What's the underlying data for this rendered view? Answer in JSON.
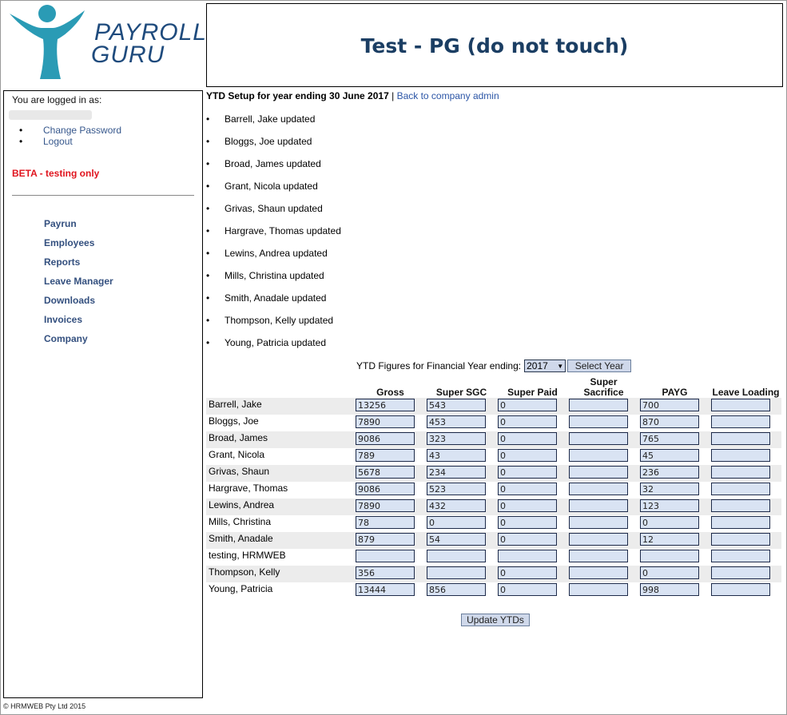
{
  "logo": {
    "line1": "PAYROLL",
    "line2": "GURU"
  },
  "header": {
    "title": "Test - PG (do not touch)"
  },
  "sidebar": {
    "logged_in_label": "You are logged in as:",
    "account_links": [
      "Change Password",
      "Logout"
    ],
    "beta_notice": "BETA - testing only",
    "nav_items": [
      "Payrun",
      "Employees",
      "Reports",
      "Leave Manager",
      "Downloads",
      "Invoices",
      "Company"
    ]
  },
  "main": {
    "setup_title": "YTD Setup for year ending 30 June 2017",
    "separator": "|",
    "back_link": "Back to company admin",
    "updated": [
      "Barrell, Jake updated",
      "Bloggs, Joe updated",
      "Broad, James updated",
      "Grant, Nicola updated",
      "Grivas, Shaun updated",
      "Hargrave, Thomas updated",
      "Lewins, Andrea updated",
      "Mills, Christina updated",
      "Smith, Anadale updated",
      "Thompson, Kelly updated",
      "Young, Patricia updated"
    ],
    "fy_label": "YTD Figures for Financial Year ending:",
    "fy_selected": "2017",
    "select_year_button": "Select Year",
    "columns": [
      "Gross",
      "Super SGC",
      "Super Paid",
      "Super Sacrifice",
      "PAYG",
      "Leave Loading"
    ],
    "rows": [
      {
        "name": "Barrell, Jake",
        "values": [
          "13256",
          "543",
          "0",
          "",
          "700",
          ""
        ]
      },
      {
        "name": "Bloggs, Joe",
        "values": [
          "7890",
          "453",
          "0",
          "",
          "870",
          ""
        ]
      },
      {
        "name": "Broad, James",
        "values": [
          "9086",
          "323",
          "0",
          "",
          "765",
          ""
        ]
      },
      {
        "name": "Grant, Nicola",
        "values": [
          "789",
          "43",
          "0",
          "",
          "45",
          ""
        ]
      },
      {
        "name": "Grivas, Shaun",
        "values": [
          "5678",
          "234",
          "0",
          "",
          "236",
          ""
        ]
      },
      {
        "name": "Hargrave, Thomas",
        "values": [
          "9086",
          "523",
          "0",
          "",
          "32",
          ""
        ]
      },
      {
        "name": "Lewins, Andrea",
        "values": [
          "7890",
          "432",
          "0",
          "",
          "123",
          ""
        ]
      },
      {
        "name": "Mills, Christina",
        "values": [
          "78",
          "0",
          "0",
          "",
          "0",
          ""
        ]
      },
      {
        "name": "Smith, Anadale",
        "values": [
          "879",
          "54",
          "0",
          "",
          "12",
          ""
        ]
      },
      {
        "name": "testing, HRMWEB",
        "values": [
          "",
          "",
          "",
          "",
          "",
          ""
        ]
      },
      {
        "name": "Thompson, Kelly",
        "values": [
          "356",
          "",
          "0",
          "",
          "0",
          ""
        ]
      },
      {
        "name": "Young, Patricia",
        "values": [
          "13444",
          "856",
          "0",
          "",
          "998",
          ""
        ]
      }
    ],
    "update_button": "Update YTDs"
  },
  "footer": {
    "copyright": "© HRMWEB Pty Ltd 2015"
  },
  "colors": {
    "brand_teal": "#2a9bb5",
    "brand_navy": "#1f4b7d",
    "beta_red": "#e0141e",
    "input_bg": "#d9e3f3"
  }
}
